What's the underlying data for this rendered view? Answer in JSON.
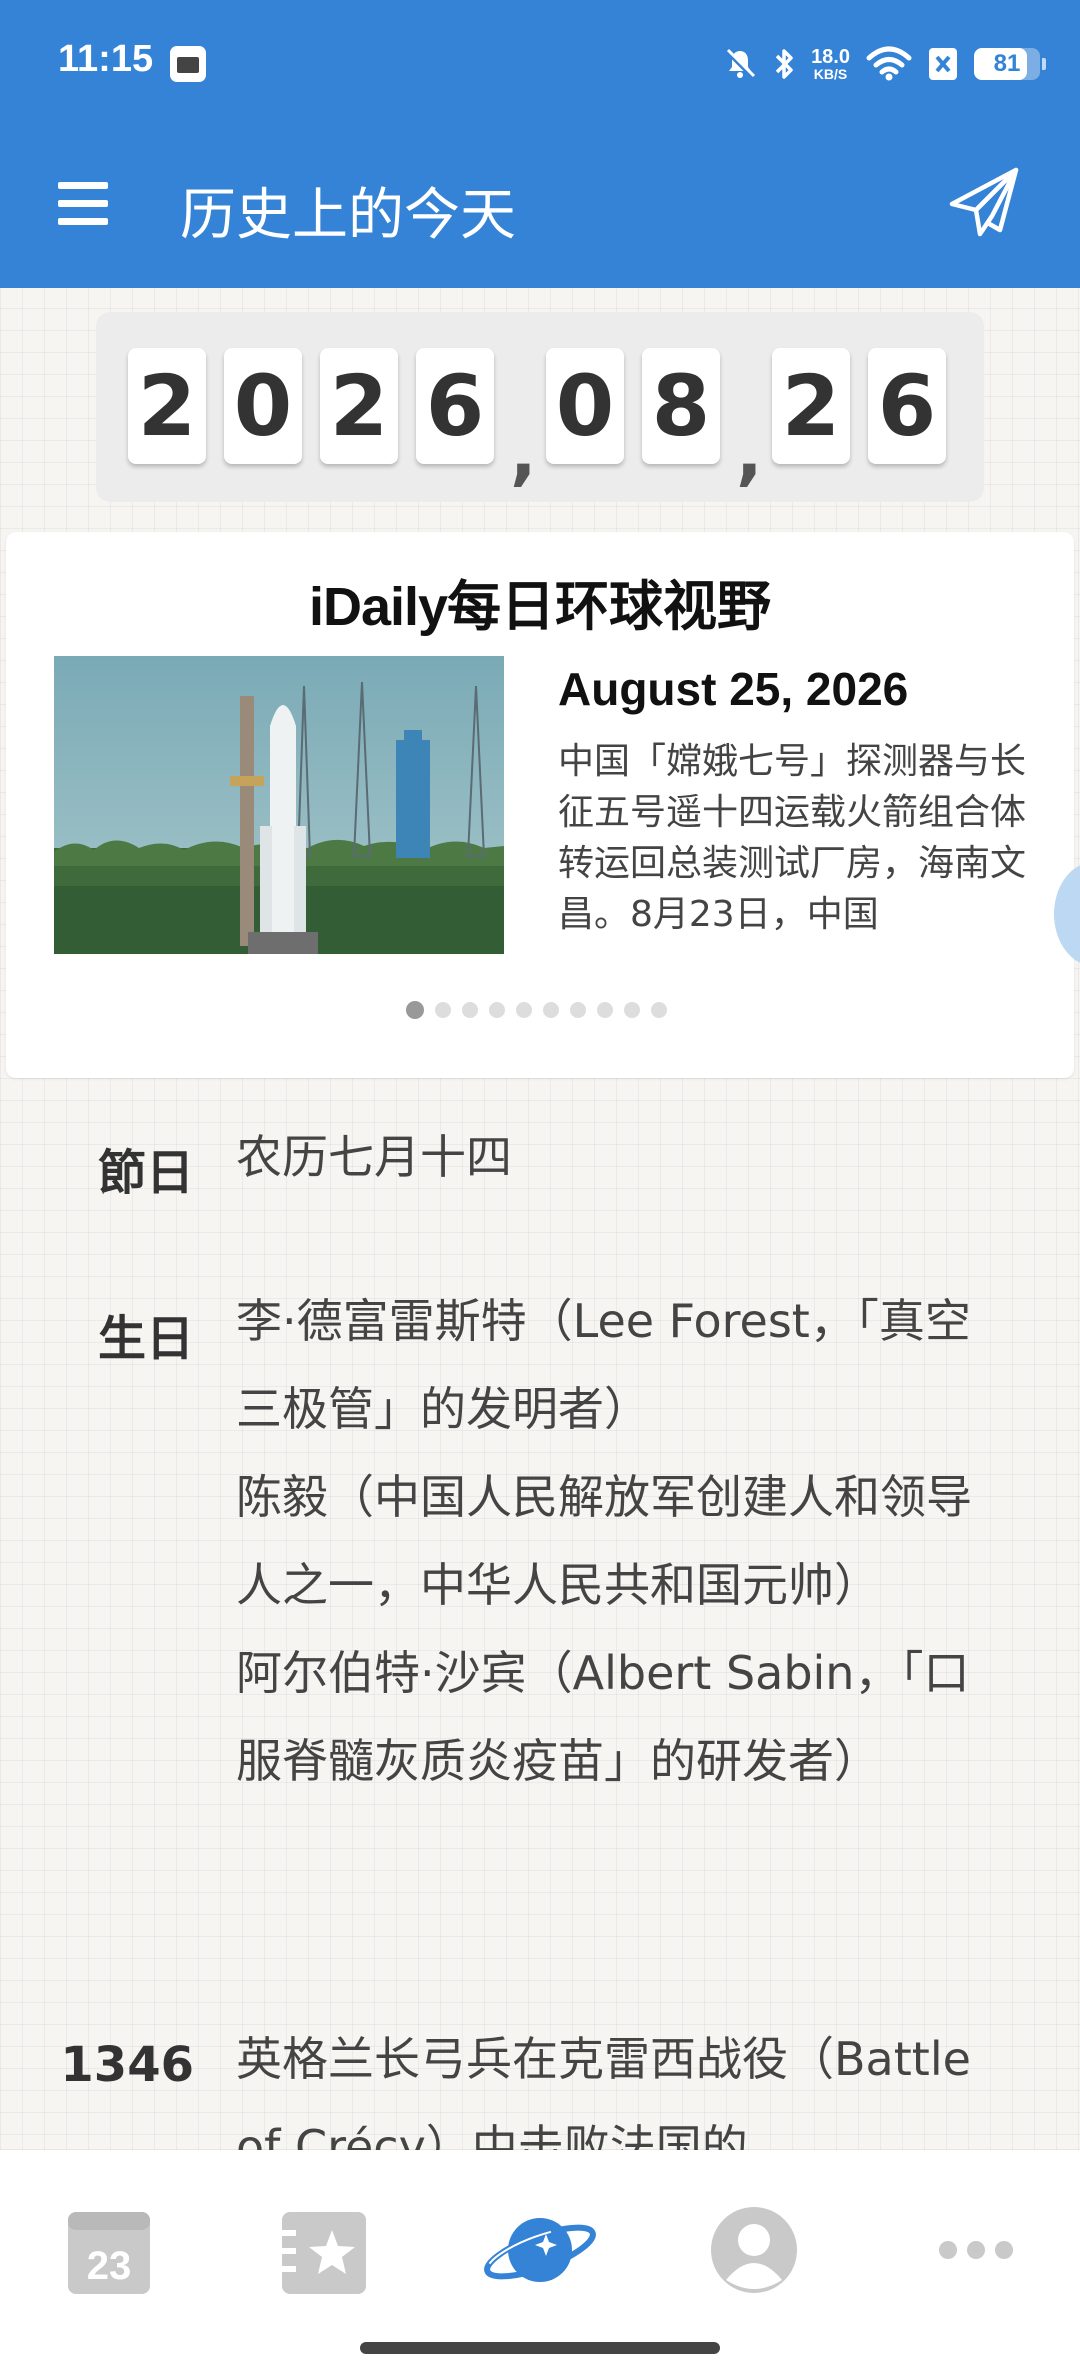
{
  "status_bar": {
    "time": "11:15",
    "speed_value": "18.0",
    "speed_unit": "KB/S",
    "battery": "81",
    "battery_level": 0.81
  },
  "app_bar": {
    "title": "历史上的今天"
  },
  "date_counter": {
    "digits": [
      "2",
      "0",
      "2",
      "6",
      "0",
      "8",
      "2",
      "6"
    ],
    "separator": ","
  },
  "feature_card": {
    "title_brand": "iDaily",
    "title_rest": "每日环球视野",
    "date": "August 25, 2026",
    "text": "中国「嫦娥七号」探测器与长征五号遥十四运载火箭组合体转运回总装测试厂房，海南文昌。8月23日，中国",
    "page_count": 10,
    "current_page": 1
  },
  "entries": [
    {
      "label": "節日",
      "text": "农历七月十四"
    },
    {
      "label": "生日",
      "text": "李·德富雷斯特（Lee Forest，「真空三极管」的发明者）\n陈毅（中国人民解放军创建人和领导人之一，中华人民共和国元帅）\n阿尔伯特·沙宾（Albert Sabin，「口服脊髓灰质炎疫苗」的研发者）"
    },
    {
      "label": "1346",
      "text": "英格兰长弓兵在克雷西战役（Battle of Crécy）中击败法国的"
    }
  ],
  "bottom_nav": {
    "calendar_day": "23",
    "items": [
      "calendar-icon",
      "favorites-icon",
      "planet-icon",
      "profile-icon",
      "more-icon"
    ],
    "active": "planet-icon",
    "colors": {
      "active": "#3483d6",
      "inactive": "#c9c9c9"
    }
  },
  "colors": {
    "primary": "#3483d6",
    "background": "#f6f5f2"
  }
}
